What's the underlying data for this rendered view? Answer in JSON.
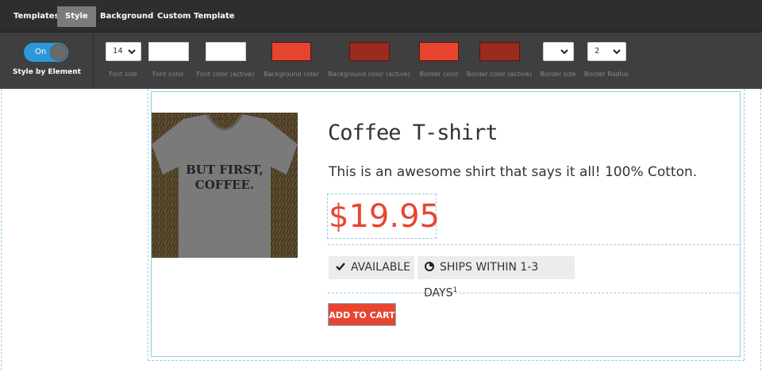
{
  "tabs": [
    {
      "label": "Templates",
      "active": false
    },
    {
      "label": "Style",
      "active": true
    },
    {
      "label": "Background",
      "active": false
    },
    {
      "label": "Custom Template",
      "active": false
    }
  ],
  "style_toggle": {
    "state": "On",
    "label": "Style by Element"
  },
  "controls": {
    "font_size": {
      "value": "14",
      "label": "Font size"
    },
    "font_color": {
      "color": "#ffffff",
      "label": "Font color"
    },
    "font_color_active": {
      "color": "#ffffff",
      "label": "Font color (active)"
    },
    "background_color": {
      "color": "#e84530",
      "label": "Background color"
    },
    "background_color_active": {
      "color": "#9b2a1f",
      "label": "Background color (active)"
    },
    "border_color": {
      "color": "#e84530",
      "label": "Border color"
    },
    "border_color_active": {
      "color": "#9b2a1f",
      "label": "Border color (active)"
    },
    "border_size": {
      "value": "",
      "label": "Border size"
    },
    "border_radius": {
      "value": "2",
      "label": "Border Radius"
    }
  },
  "product": {
    "image_text_line1": "BUT FIRST,",
    "image_text_line2": "COFFEE.",
    "title": "Coffee T-shirt",
    "description": "This is an awesome shirt that says it all! 100% Cotton.",
    "price": "$19.95",
    "badges": {
      "available": "AVAILABLE",
      "ships": "SHIPS WITHIN 1-3 DAYS",
      "ships_footnote": "1"
    },
    "add_to_cart": "ADD TO CART"
  },
  "colors": {
    "accent": "#e84530",
    "accent_dark": "#9b2a1f",
    "toggle": "#2b98db"
  }
}
